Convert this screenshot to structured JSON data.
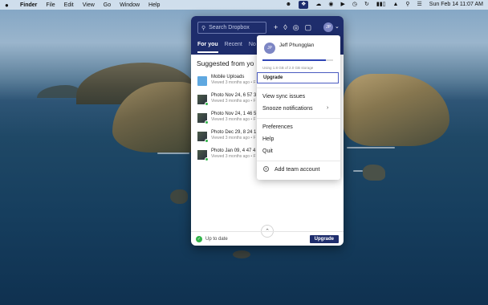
{
  "menubar": {
    "app_name": "Finder",
    "items": [
      "File",
      "Edit",
      "View",
      "Go",
      "Window",
      "Help"
    ],
    "clock": "Sun Feb 14  11:07 AM",
    "status_icons": [
      "dropbox-icon",
      "creative-cloud-icon",
      "camera-icon",
      "play-icon",
      "clock-icon",
      "sync-icon",
      "battery-icon",
      "wifi-icon",
      "search-icon",
      "control-center-icon"
    ]
  },
  "dropbox": {
    "search_placeholder": "Search Dropbox",
    "avatar_initials": "JP",
    "tabs": [
      "For you",
      "Recent",
      "No"
    ],
    "section_title": "Suggested from yo",
    "files": [
      {
        "name": "Mobile Uploads",
        "sub": "Viewed 3 months ago • F",
        "kind": "folder"
      },
      {
        "name": "Photo Nov 24, 6 57 3",
        "sub": "Viewed 3 months ago • F",
        "kind": "photo"
      },
      {
        "name": "Photo Nov 24, 1 46 5",
        "sub": "Viewed 3 months ago • F",
        "kind": "photo"
      },
      {
        "name": "Photo Dec 29, 8 24 1",
        "sub": "Viewed 3 months ago • F",
        "kind": "photo"
      },
      {
        "name": "Photo Jan 09, 4 47 4",
        "sub": "Viewed 3 months ago • F",
        "kind": "photo"
      }
    ],
    "footer_status": "Up to date",
    "footer_upgrade": "Upgrade"
  },
  "account_menu": {
    "initials": "JP",
    "user_name": "Jeff Phungglan",
    "usage_text": "Using 1.8 GB of 2.0 GB storage",
    "usage_fraction": 0.9,
    "upgrade": "Upgrade",
    "items": [
      "View sync issues",
      "Snooze notifications",
      "Preferences",
      "Help",
      "Quit"
    ],
    "add_team": "Add team account"
  }
}
